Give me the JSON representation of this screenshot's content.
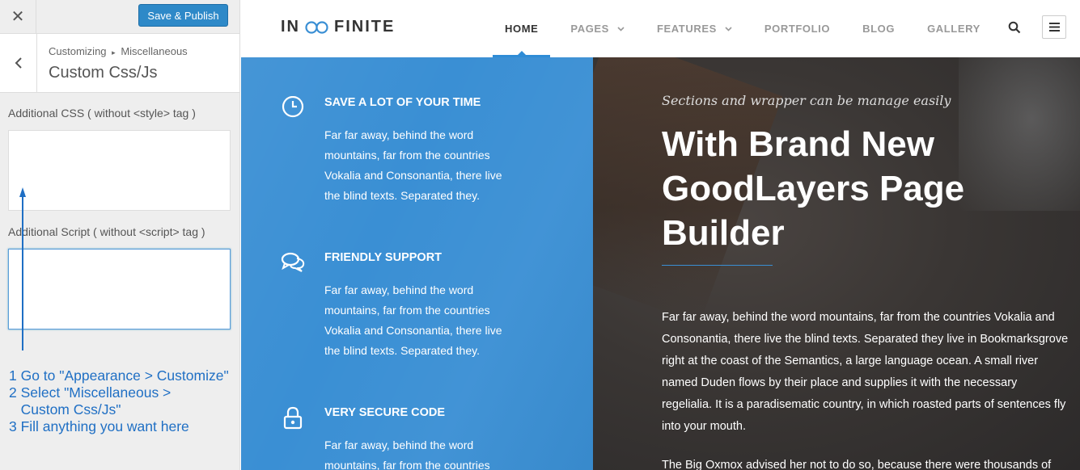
{
  "customizer": {
    "close_icon": "close-icon",
    "save_label": "Save & Publish",
    "breadcrumb": {
      "parent": "Customizing",
      "separator": "▸",
      "section": "Miscellaneous"
    },
    "title": "Custom Css/Js",
    "css_field": {
      "label": "Additional CSS ( without <style> tag )",
      "value": ""
    },
    "script_field": {
      "label": "Additional Script ( without <script> tag )",
      "value": ""
    },
    "help_steps": [
      "1 Go to \"Appearance > Customize\"",
      "2 Select \"Miscellaneous >",
      "   Custom Css/Js\"",
      "3 Fill anything you want here"
    ],
    "accent": "#2e89c8",
    "annotation_color": "#1f6fc4"
  },
  "site": {
    "logo": {
      "left": "IN",
      "right": "FINITE"
    },
    "menu": [
      {
        "label": "HOME",
        "active": true,
        "dropdown": false
      },
      {
        "label": "PAGES",
        "active": false,
        "dropdown": true
      },
      {
        "label": "FEATURES",
        "active": false,
        "dropdown": true
      },
      {
        "label": "PORTFOLIO",
        "active": false,
        "dropdown": false
      },
      {
        "label": "BLOG",
        "active": false,
        "dropdown": false
      },
      {
        "label": "GALLERY",
        "active": false,
        "dropdown": false
      }
    ],
    "features": [
      {
        "icon": "clock-icon",
        "title": "SAVE A LOT OF YOUR TIME",
        "text": "Far far away, behind the word mountains, far from the countries Vokalia and Consonantia, there live the blind texts. Separated they."
      },
      {
        "icon": "chat-bubbles-icon",
        "title": "FRIENDLY SUPPORT",
        "text": "Far far away, behind the word mountains, far from the countries Vokalia and Consonantia, there live the blind texts. Separated they."
      },
      {
        "icon": "lock-icon",
        "title": "VERY SECURE CODE",
        "text": "Far far away, behind the word mountains, far from the countries"
      }
    ],
    "hero": {
      "caption": "Sections and wrapper can be manage easily",
      "title": "With Brand New GoodLayers Page Builder",
      "body": "Far far away, behind the word mountains, far from the countries Vokalia and Consonantia, there live the blind texts. Separated they live in Bookmarksgrove right at the coast of the Semantics, a large language ocean. A small river named Duden flows by their place and supplies it with the necessary regelialia. It is a paradisematic country, in which roasted parts of sentences fly into your mouth.",
      "body2": "The Big Oxmox advised her not to do so, because there were thousands of"
    },
    "brand_blue": "#3a8fd4"
  }
}
